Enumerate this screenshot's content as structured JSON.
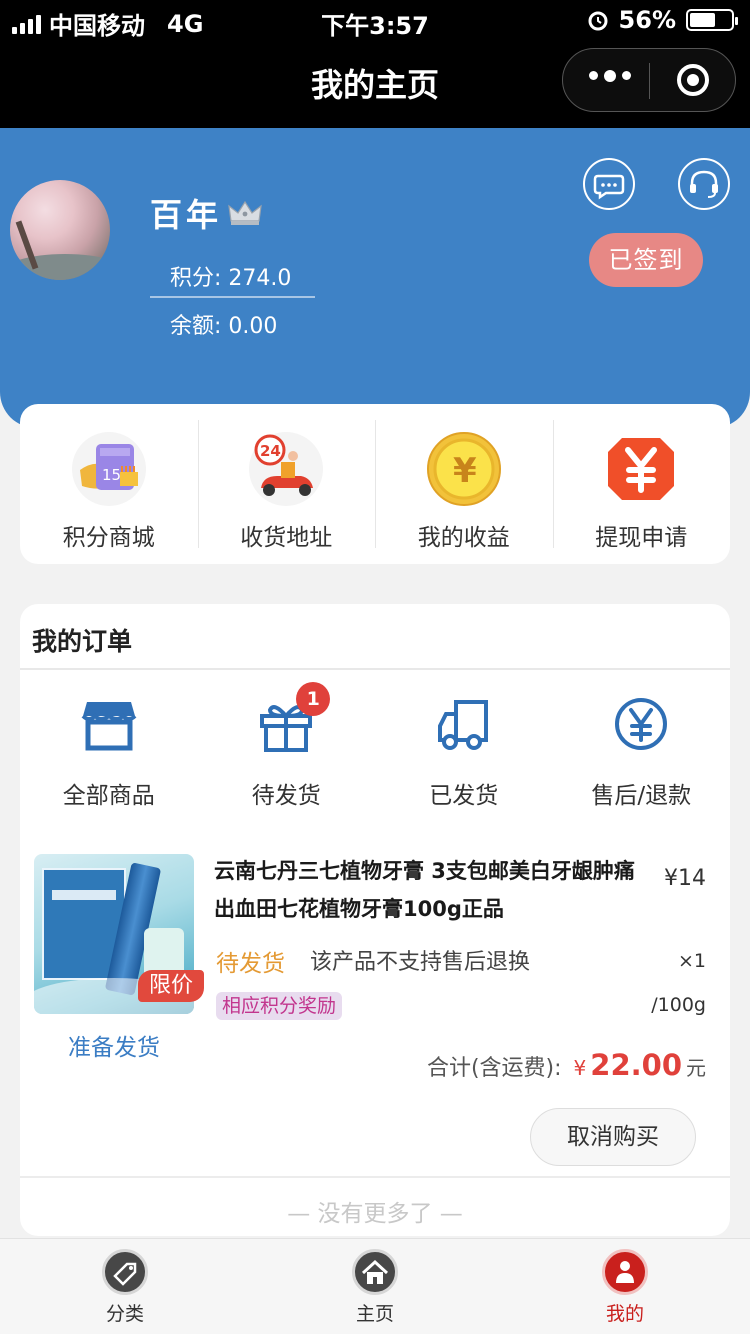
{
  "status_bar": {
    "carrier": "中国移动",
    "network": "4G",
    "time": "下午3:57",
    "battery": "56%"
  },
  "nav": {
    "title": "我的主页"
  },
  "profile": {
    "name": "百年",
    "points_label": "积分:",
    "points_value": "274.0",
    "balance_label": "余额:",
    "balance_value": "0.00",
    "signed_label": "已签到"
  },
  "features": [
    {
      "label": "积分商城",
      "icon": "points-mall-icon"
    },
    {
      "label": "收货地址",
      "icon": "delivery-address-icon"
    },
    {
      "label": "我的收益",
      "icon": "earnings-icon"
    },
    {
      "label": "提现申请",
      "icon": "withdraw-icon"
    }
  ],
  "orders": {
    "title": "我的订单",
    "statuses": [
      {
        "label": "全部商品",
        "icon": "shop-icon"
      },
      {
        "label": "待发货",
        "icon": "gift-icon",
        "badge": "1"
      },
      {
        "label": "已发货",
        "icon": "truck-icon"
      },
      {
        "label": "售后/退款",
        "icon": "yen-icon"
      }
    ],
    "item": {
      "tag": "限价",
      "shipping_note": "准备发货",
      "name": "云南七丹三七植物牙膏 3支包邮美白牙龈肿痛出血田七花植物牙膏100g正品",
      "price": "¥14",
      "state": "待发货",
      "return_policy": "该产品不支持售后退换",
      "quantity": "×1",
      "points_tag": "相应积分奖励",
      "spec": "/100g",
      "total_label": "合计(含运费):",
      "currency": "¥",
      "total_value": "22.00",
      "unit": "元",
      "cancel_label": "取消购买"
    },
    "no_more": "— 没有更多了 —"
  },
  "tabbar": [
    {
      "label": "分类",
      "icon": "category-icon",
      "active": false
    },
    {
      "label": "主页",
      "icon": "home-icon",
      "active": false
    },
    {
      "label": "我的",
      "icon": "profile-icon",
      "active": true
    }
  ],
  "colors": {
    "header_blue": "#3e82c6",
    "accent_red": "#e0413b",
    "order_pending": "#e49a34",
    "tab_active": "#c9201d"
  }
}
